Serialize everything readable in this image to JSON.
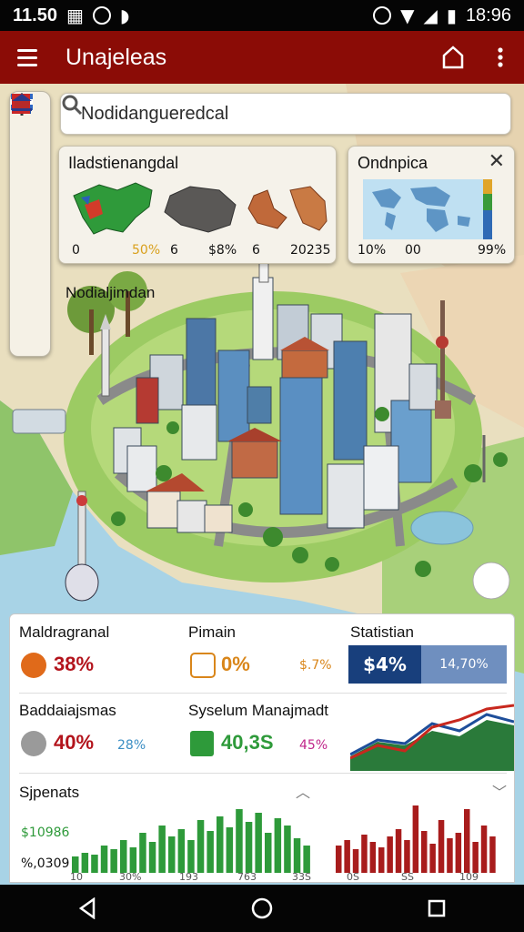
{
  "status_bar": {
    "left_text": "11.50",
    "time": "18:96"
  },
  "app_bar": {
    "title": "Unajeleas"
  },
  "search": {
    "value": "Nodidangueredcal"
  },
  "map_label": "Nodialjimdan",
  "region_card": {
    "title": "Iladstienangdal",
    "values": [
      "0",
      "50%",
      "6",
      "$8%",
      "6",
      "20235"
    ]
  },
  "overview_card": {
    "title": "Ondnpica",
    "values": [
      "10%",
      "00",
      "99%"
    ]
  },
  "metrics": [
    {
      "title": "Maldragranal",
      "value": "38%",
      "color": "#b3141c"
    },
    {
      "title": "Pimain",
      "value": "0%",
      "sub": "$.7%",
      "color": "#d9861a"
    },
    {
      "title": "Statistian",
      "value": "$4%",
      "sub": "14,70%"
    },
    {
      "title": "Baddaiajsmas",
      "value": "40%",
      "sub": "28%",
      "color": "#b3141c"
    },
    {
      "title": "Syselum Manajmadt",
      "value": "40,3S",
      "sub": "45%",
      "color": "#2e9a3a"
    }
  ],
  "spends": {
    "title": "Sjpenats",
    "y_labels": [
      "$10986",
      "%,0309"
    ],
    "x_labels": [
      "10",
      "30%",
      "193",
      "763",
      "33S",
      "0S",
      "SS",
      "109"
    ]
  },
  "colors": {
    "brand": "#8b0c06",
    "green": "#2e9a3a",
    "red": "#b3141c",
    "navy": "#183f7c"
  }
}
